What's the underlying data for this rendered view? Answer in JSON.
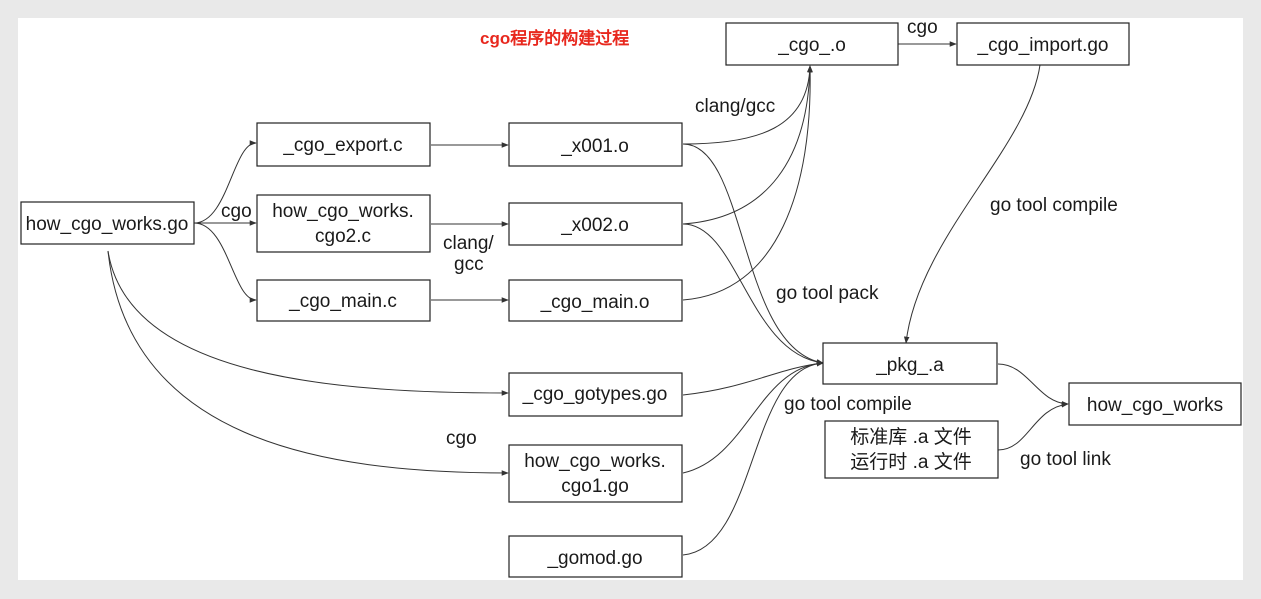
{
  "title": "cgo程序的构建过程",
  "colors": {
    "title": "#e8281e",
    "border": "#222222",
    "text": "#1a1a1a"
  },
  "nodes": {
    "cgo_o": "_cgo_.o",
    "cgo_import": "_cgo_import.go",
    "cgo_export": "_cgo_export.c",
    "x001": "_x001.o",
    "how_cgo_works_go": "how_cgo_works.go",
    "cgo2_c_line1": "how_cgo_works.",
    "cgo2_c_line2": "cgo2.c",
    "x002": "_x002.o",
    "cgo_main_c": "_cgo_main.c",
    "cgo_main_o": "_cgo_main.o",
    "pkg_a": "_pkg_.a",
    "cgo_gotypes": "_cgo_gotypes.go",
    "cgo1_go_line1": "how_cgo_works.",
    "cgo1_go_line2": "cgo1.go",
    "gomod": "_gomod.go",
    "stdlib_line1": "标准库 .a 文件",
    "stdlib_line2": "运行时 .a 文件",
    "how_cgo_works": "how_cgo_works"
  },
  "edge_labels": {
    "cgo_top": "cgo",
    "clang_gcc_top": "clang/gcc",
    "cgo_left": "cgo",
    "clang_line1": "clang/",
    "clang_line2": "gcc",
    "go_tool_compile_top": "go tool compile",
    "go_tool_pack": "go tool pack",
    "go_tool_compile_bottom": "go tool compile",
    "cgo_bottom": "cgo",
    "go_tool_link": "go tool link"
  }
}
